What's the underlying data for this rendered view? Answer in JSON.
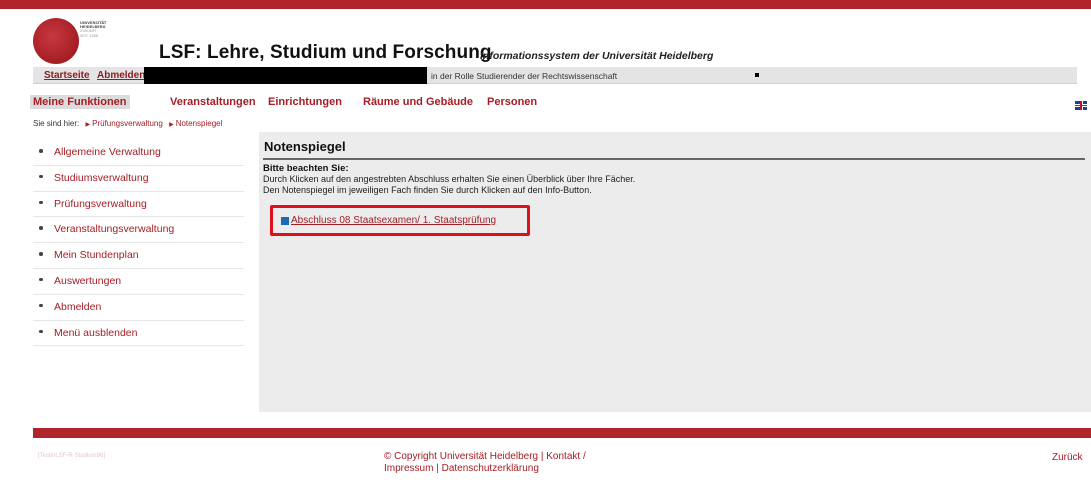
{
  "header": {
    "logo_lines": [
      "UNIVERSITÄT",
      "HEIDELBERG",
      "ZUKUNFT",
      "SEIT 1386"
    ],
    "title": "LSF: Lehre, Studium und Forschung",
    "subtitle": "Informationssystem der Universität Heidelberg"
  },
  "user_bar": {
    "home_label": "Startseite",
    "logout_label": "Abmelden",
    "role_text": "in der Rolle Studierender der Rechtswissenschaft"
  },
  "main_nav": {
    "items": [
      "Meine Funktionen",
      "Veranstaltungen",
      "Einrichtungen",
      "Räume und Gebäude",
      "Personen"
    ]
  },
  "breadcrumb": {
    "prefix": "Sie sind hier:",
    "items": [
      "Prüfungsverwaltung",
      "Notenspiegel"
    ]
  },
  "sidebar": {
    "items": [
      "Allgemeine Verwaltung",
      "Studiumsverwaltung",
      "Prüfungsverwaltung",
      "Veranstaltungsverwaltung",
      "Mein Stundenplan",
      "Auswertungen",
      "Abmelden",
      "Menü ausblenden"
    ]
  },
  "content": {
    "title": "Notenspiegel",
    "note_heading": "Bitte beachten Sie:",
    "note_line1": "Durch Klicken auf den angestrebten Abschluss erhalten Sie einen Überblick über Ihre Fächer.",
    "note_line2": "Den Notenspiegel im jeweiligen Fach finden Sie durch Klicken auf den Info-Button.",
    "abschluss_link": "Abschluss 08 Staatsexamen/ 1. Staatsprüfung"
  },
  "footer": {
    "ghost_text": "[TestinLSF-R-Studium96]",
    "copyright_line1": "© Copyright Universität Heidelberg | Kontakt /",
    "copyright_line2": "Impressum | Datenschutzerklärung",
    "back_label": "Zurück"
  },
  "colors": {
    "brand_red": "#b0242b",
    "link_red": "#a51e25",
    "highlight_box": "#e0101a",
    "content_bg": "#ececec"
  }
}
